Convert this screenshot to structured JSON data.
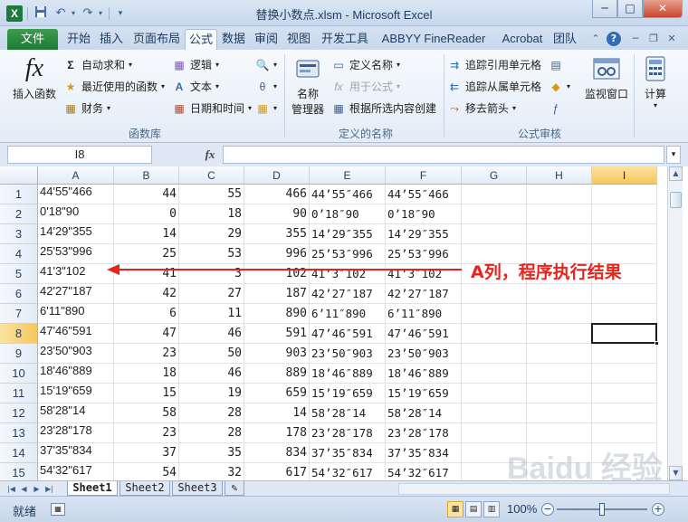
{
  "window": {
    "title": "替换小数点.xlsm - Microsoft Excel",
    "app_icon": "X",
    "qat": {
      "save_icon": "save-icon",
      "undo_icon": "undo-icon",
      "redo_icon": "redo-icon",
      "customize_icon": "customize-qat-icon"
    },
    "buttons": {
      "minimize": "─",
      "restore": "□",
      "close": "✕"
    }
  },
  "tabs": [
    {
      "label": "文件",
      "active": false
    },
    {
      "label": "开始",
      "active": false
    },
    {
      "label": "插入",
      "active": false
    },
    {
      "label": "页面布局",
      "active": false
    },
    {
      "label": "公式",
      "active": true
    },
    {
      "label": "数据",
      "active": false
    },
    {
      "label": "审阅",
      "active": false
    },
    {
      "label": "视图",
      "active": false
    },
    {
      "label": "开发工具",
      "active": false
    },
    {
      "label": "ABBYY FineReader 11",
      "active": false
    },
    {
      "label": "Acrobat",
      "active": false
    },
    {
      "label": "团队",
      "active": false
    }
  ],
  "ribbon": {
    "function_library": {
      "insert_function": "插入函数",
      "fx_glyph": "fx",
      "autosum": "自动求和",
      "recently_used": "最近使用的函数",
      "financial": "财务",
      "logical": "逻辑",
      "text": "文本",
      "date_time": "日期和时间",
      "group_label": "函数库"
    },
    "defined_names": {
      "name_manager_line1": "名称",
      "name_manager_line2": "管理器",
      "define_name": "定义名称",
      "use_in_formula": "用于公式",
      "create_from_selection": "根据所选内容创建",
      "group_label": "定义的名称"
    },
    "formula_auditing": {
      "trace_precedents": "追踪引用单元格",
      "trace_dependents": "追踪从属单元格",
      "remove_arrows": "移去箭头",
      "watch_window": "监视窗口",
      "group_label": "公式审核"
    },
    "calculation": {
      "label": "计算"
    }
  },
  "formula_bar": {
    "name_box": "I8",
    "fx": "fx",
    "content": ""
  },
  "grid": {
    "columns": [
      "A",
      "B",
      "C",
      "D",
      "E",
      "F",
      "G",
      "H",
      "I"
    ],
    "selected_column": "I",
    "selected_row": 8,
    "active_cell": "I8",
    "rows": [
      {
        "n": "1",
        "A": "44'55\"466",
        "B": "44",
        "C": "55",
        "D": "466",
        "E": "44’55″466",
        "F": "44’55″466"
      },
      {
        "n": "2",
        "A": "0'18\"90",
        "B": "0",
        "C": "18",
        "D": "90",
        "E": "0’18″90",
        "F": "0’18″90"
      },
      {
        "n": "3",
        "A": "14'29\"355",
        "B": "14",
        "C": "29",
        "D": "355",
        "E": "14’29″355",
        "F": "14’29″355"
      },
      {
        "n": "4",
        "A": "25'53\"996",
        "B": "25",
        "C": "53",
        "D": "996",
        "E": "25’53″996",
        "F": "25’53″996"
      },
      {
        "n": "5",
        "A": "41'3\"102",
        "B": "41",
        "C": "3",
        "D": "102",
        "E": "41’3″102",
        "F": "41’3″102"
      },
      {
        "n": "6",
        "A": "42'27\"187",
        "B": "42",
        "C": "27",
        "D": "187",
        "E": "42’27″187",
        "F": "42’27″187"
      },
      {
        "n": "7",
        "A": "6'11\"890",
        "B": "6",
        "C": "11",
        "D": "890",
        "E": "6’11″890",
        "F": "6’11″890"
      },
      {
        "n": "8",
        "A": "47'46\"591",
        "B": "47",
        "C": "46",
        "D": "591",
        "E": "47’46″591",
        "F": "47’46″591"
      },
      {
        "n": "9",
        "A": "23'50\"903",
        "B": "23",
        "C": "50",
        "D": "903",
        "E": "23’50″903",
        "F": "23’50″903"
      },
      {
        "n": "10",
        "A": "18'46\"889",
        "B": "18",
        "C": "46",
        "D": "889",
        "E": "18’46″889",
        "F": "18’46″889"
      },
      {
        "n": "11",
        "A": "15'19\"659",
        "B": "15",
        "C": "19",
        "D": "659",
        "E": "15’19″659",
        "F": "15’19″659"
      },
      {
        "n": "12",
        "A": "58'28\"14",
        "B": "58",
        "C": "28",
        "D": "14",
        "E": "58’28″14",
        "F": "58’28″14"
      },
      {
        "n": "13",
        "A": "23'28\"178",
        "B": "23",
        "C": "28",
        "D": "178",
        "E": "23’28″178",
        "F": "23’28″178"
      },
      {
        "n": "14",
        "A": "37'35\"834",
        "B": "37",
        "C": "35",
        "D": "834",
        "E": "37’35″834",
        "F": "37’35″834"
      },
      {
        "n": "15",
        "A": "54'32\"617",
        "B": "54",
        "C": "32",
        "D": "617",
        "E": "54’32″617",
        "F": "54’32″617"
      }
    ]
  },
  "annotation": {
    "text": "A列，程序执行结果",
    "color": "#e8231c"
  },
  "sheets": [
    "Sheet1",
    "Sheet2",
    "Sheet3"
  ],
  "active_sheet": "Sheet1",
  "status": {
    "ready": "就绪",
    "zoom": "100%",
    "zoom_out": "−",
    "zoom_in": "+"
  },
  "colors": {
    "excel_green": "#1f7a34",
    "selection_highlight": "#f5c75c",
    "annotation_red": "#e8231c"
  }
}
